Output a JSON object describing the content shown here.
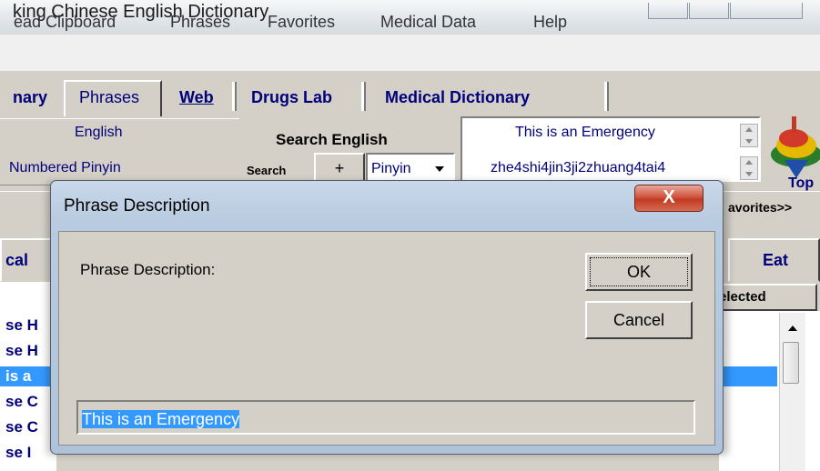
{
  "window": {
    "title": "king Chinese English Dictionary"
  },
  "menu": [
    "ead Clipboard",
    "Phrases",
    "Favorites",
    "Medical Data",
    "Help"
  ],
  "tabs": [
    {
      "label": "nary",
      "bold": true
    },
    {
      "label": "Phrases",
      "bold": false
    },
    {
      "label": "Web",
      "bold": true
    },
    {
      "label": "Drugs Lab",
      "bold": true
    },
    {
      "label": "Medical Dictionary",
      "bold": true
    }
  ],
  "search": {
    "field_english": "English",
    "field_pinyin": "Numbered Pinyin",
    "search_english_label": "Search English",
    "search_label": "Search",
    "plus_label": "+",
    "pinyin_select": "Pinyin",
    "result_english": "This is an Emergency",
    "result_pinyin": "zhe4shi4jin3ji2zhuang4tai4",
    "top_label": "Top",
    "favorites_label": "avorites>>"
  },
  "panels": {
    "left_tab": "cal",
    "right_tab": "Eat",
    "selected_header": "elected"
  },
  "list_rows": [
    {
      "text": "se H",
      "selected": false
    },
    {
      "text": "se H",
      "selected": false
    },
    {
      "text": "is a",
      "selected": true
    },
    {
      "text": "se C",
      "selected": false
    },
    {
      "text": "se C",
      "selected": false
    },
    {
      "text": "se I",
      "selected": false
    }
  ],
  "dialog": {
    "title": "Phrase Description",
    "close_glyph": "X",
    "prompt": "Phrase Description:",
    "ok_label": "OK",
    "cancel_label": "Cancel",
    "input_value": "This is an Emergency"
  },
  "colors": {
    "selection": "#3399ff",
    "close_button": "#c94a34",
    "link_text": "#00007a"
  }
}
